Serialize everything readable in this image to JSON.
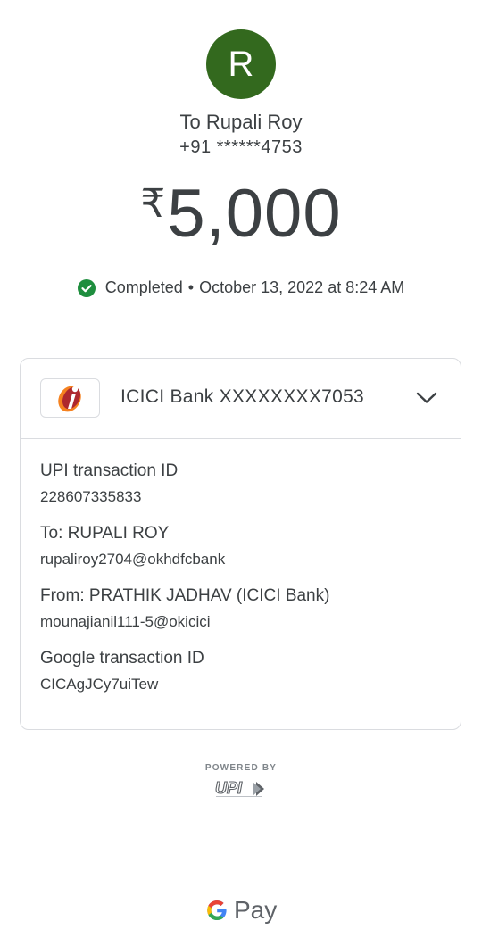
{
  "recipient": {
    "initial": "R",
    "avatar_color": "#33691e",
    "label": "To Rupali Roy",
    "phone": "+91 ******4753"
  },
  "payment": {
    "currency_symbol": "₹",
    "amount": "5,000",
    "status": "Completed",
    "separator": "•",
    "datetime": "October 13, 2022 at 8:24 AM",
    "status_color": "#1e8e3e"
  },
  "account": {
    "bank_icon": "icici-logo-icon",
    "bank_name": "ICICI Bank XXXXXXXX7053",
    "expand_icon": "chevron-down-icon"
  },
  "details": [
    {
      "label": "UPI transaction ID",
      "value": "228607335833"
    },
    {
      "label": "To: RUPALI ROY",
      "value": "rupaliroy2704@okhdfcbank"
    },
    {
      "label": "From: PRATHIK JADHAV (ICICI Bank)",
      "value": "mounajianil111-5@okicici"
    },
    {
      "label": "Google transaction ID",
      "value": "CICAgJCy7uiTew"
    }
  ],
  "footer": {
    "powered_by": "POWERED BY",
    "upi_logo": "UPI",
    "brand": "Pay",
    "brand_icon": "google-g-icon"
  }
}
